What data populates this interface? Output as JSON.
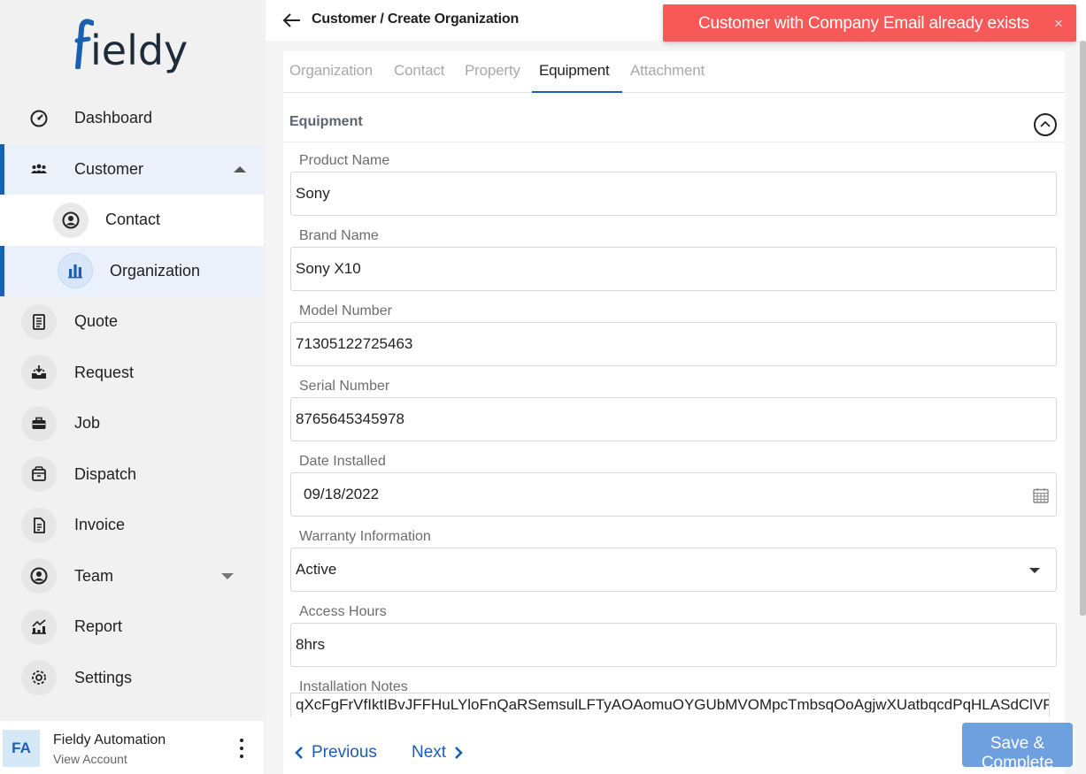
{
  "brand": {
    "logo_text": "ieldy"
  },
  "sidebar": {
    "items": [
      {
        "label": "Dashboard",
        "icon": "dashboard-gauge-icon"
      },
      {
        "label": "Customer",
        "icon": "users-group-icon",
        "expanded": true
      },
      {
        "label": "Contact",
        "icon": "user-circle-icon"
      },
      {
        "label": "Organization",
        "icon": "building-chart-icon"
      },
      {
        "label": "Quote",
        "icon": "document-list-icon"
      },
      {
        "label": "Request",
        "icon": "inbox-request-icon"
      },
      {
        "label": "Job",
        "icon": "briefcase-icon"
      },
      {
        "label": "Dispatch",
        "icon": "package-icon"
      },
      {
        "label": "Invoice",
        "icon": "invoice-icon"
      },
      {
        "label": "Team",
        "icon": "user-circle-icon",
        "expanded": false
      },
      {
        "label": "Report",
        "icon": "chart-report-icon"
      },
      {
        "label": "Settings",
        "icon": "gear-icon"
      }
    ]
  },
  "account": {
    "initials": "FA",
    "name": "Fieldy Automation",
    "sub": "View Account"
  },
  "header": {
    "breadcrumb": "Customer / Create Organization"
  },
  "tabs": [
    "Organization",
    "Contact",
    "Property",
    "Equipment",
    "Attachment"
  ],
  "active_tab": "Equipment",
  "section": {
    "title": "Equipment"
  },
  "form": {
    "product_name": {
      "label": "Product Name",
      "value": "Sony"
    },
    "brand_name": {
      "label": "Brand Name",
      "value": "Sony X10"
    },
    "model_number": {
      "label": "Model Number",
      "value": "71305122725463"
    },
    "serial_number": {
      "label": "Serial Number",
      "value": "8765645345978"
    },
    "date_installed": {
      "label": "Date Installed",
      "value": "09/18/2022"
    },
    "warranty": {
      "label": "Warranty Information",
      "value": "Active"
    },
    "access_hours": {
      "label": "Access Hours",
      "value": "8hrs"
    },
    "installation_notes": {
      "label": "Installation Notes",
      "value": "qXcFgFrVfIktIBvJFFHuLYloFnQaRSemsulLFTyAOAomuOYGUbMVOMpcTmbsqOoAgjwXUatbqcdPqHLASdClVPMh"
    }
  },
  "buttons": {
    "previous": "Previous",
    "next": "Next",
    "save": "Save & Complete"
  },
  "toast": {
    "message": "Customer with Company Email already exists",
    "close": "×"
  },
  "colors": {
    "accent": "#1a5fb4",
    "toast": "#f75959",
    "save": "#6e9fde"
  }
}
